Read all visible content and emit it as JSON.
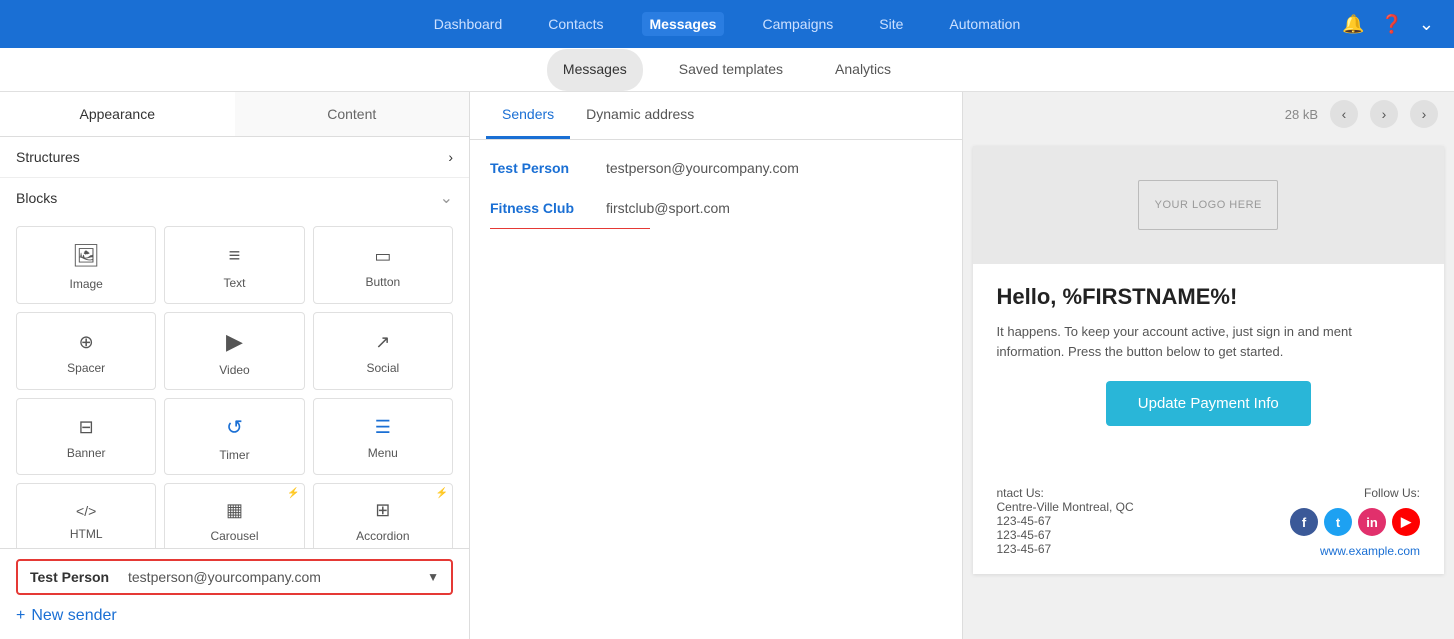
{
  "topNav": {
    "links": [
      "Dashboard",
      "Contacts",
      "Messages",
      "Campaigns",
      "Site",
      "Automation"
    ],
    "activeLink": "Messages",
    "icons": [
      "bell",
      "question",
      "chevron-down"
    ]
  },
  "subNav": {
    "items": [
      "Messages",
      "Saved templates",
      "Analytics"
    ],
    "activeItem": "Messages"
  },
  "leftPanel": {
    "tabs": [
      "Appearance",
      "Content"
    ],
    "activeTab": "Appearance",
    "structuresLabel": "Structures",
    "blocksLabel": "Blocks",
    "blocks": [
      {
        "id": "image",
        "label": "Image",
        "icon": "🖼"
      },
      {
        "id": "text",
        "label": "Text",
        "icon": "☰"
      },
      {
        "id": "button",
        "label": "Button",
        "icon": "▭"
      },
      {
        "id": "spacer",
        "label": "Spacer",
        "icon": "÷"
      },
      {
        "id": "video",
        "label": "Video",
        "icon": "▶"
      },
      {
        "id": "social",
        "label": "Social",
        "icon": "🔗"
      },
      {
        "id": "banner",
        "label": "Banner",
        "icon": "☰"
      },
      {
        "id": "timer",
        "label": "Timer",
        "icon": "↺"
      },
      {
        "id": "menu",
        "label": "Menu",
        "icon": "☰"
      },
      {
        "id": "html",
        "label": "HTML",
        "icon": "</>"
      },
      {
        "id": "carousel",
        "label": "Carousel",
        "icon": "▦"
      },
      {
        "id": "accordion",
        "label": "Accordion",
        "icon": "☰"
      }
    ]
  },
  "senderPanel": {
    "tabs": [
      "Senders",
      "Dynamic address"
    ],
    "activeTab": "Senders",
    "senders": [
      {
        "name": "Test Person",
        "email": "testperson@yourcompany.com",
        "selected": true
      },
      {
        "name": "Fitness Club",
        "email": "firstclub@sport.com",
        "selected": false
      }
    ]
  },
  "senderBar": {
    "selectedName": "Test Person",
    "selectedEmail": "testperson@yourcompany.com",
    "newSenderLabel": "New sender"
  },
  "preview": {
    "size": "28 kB",
    "logoText": "YOUR LOGO HERE",
    "greeting": "Hello, %FIRSTNAME%!",
    "bodyText": "It happens. To keep your account active, just sign in and ment information. Press the button below to get started.",
    "buttonLabel": "Update Payment Info",
    "footer": {
      "contactLabel": "ntact Us:",
      "address1": "Centre-Ville Montreal, QC",
      "phone1": "123-45-67",
      "phone2": "123-45-67",
      "phone3": "123-45-67",
      "followLabel": "Follow Us:",
      "link": "www.example.com"
    }
  }
}
